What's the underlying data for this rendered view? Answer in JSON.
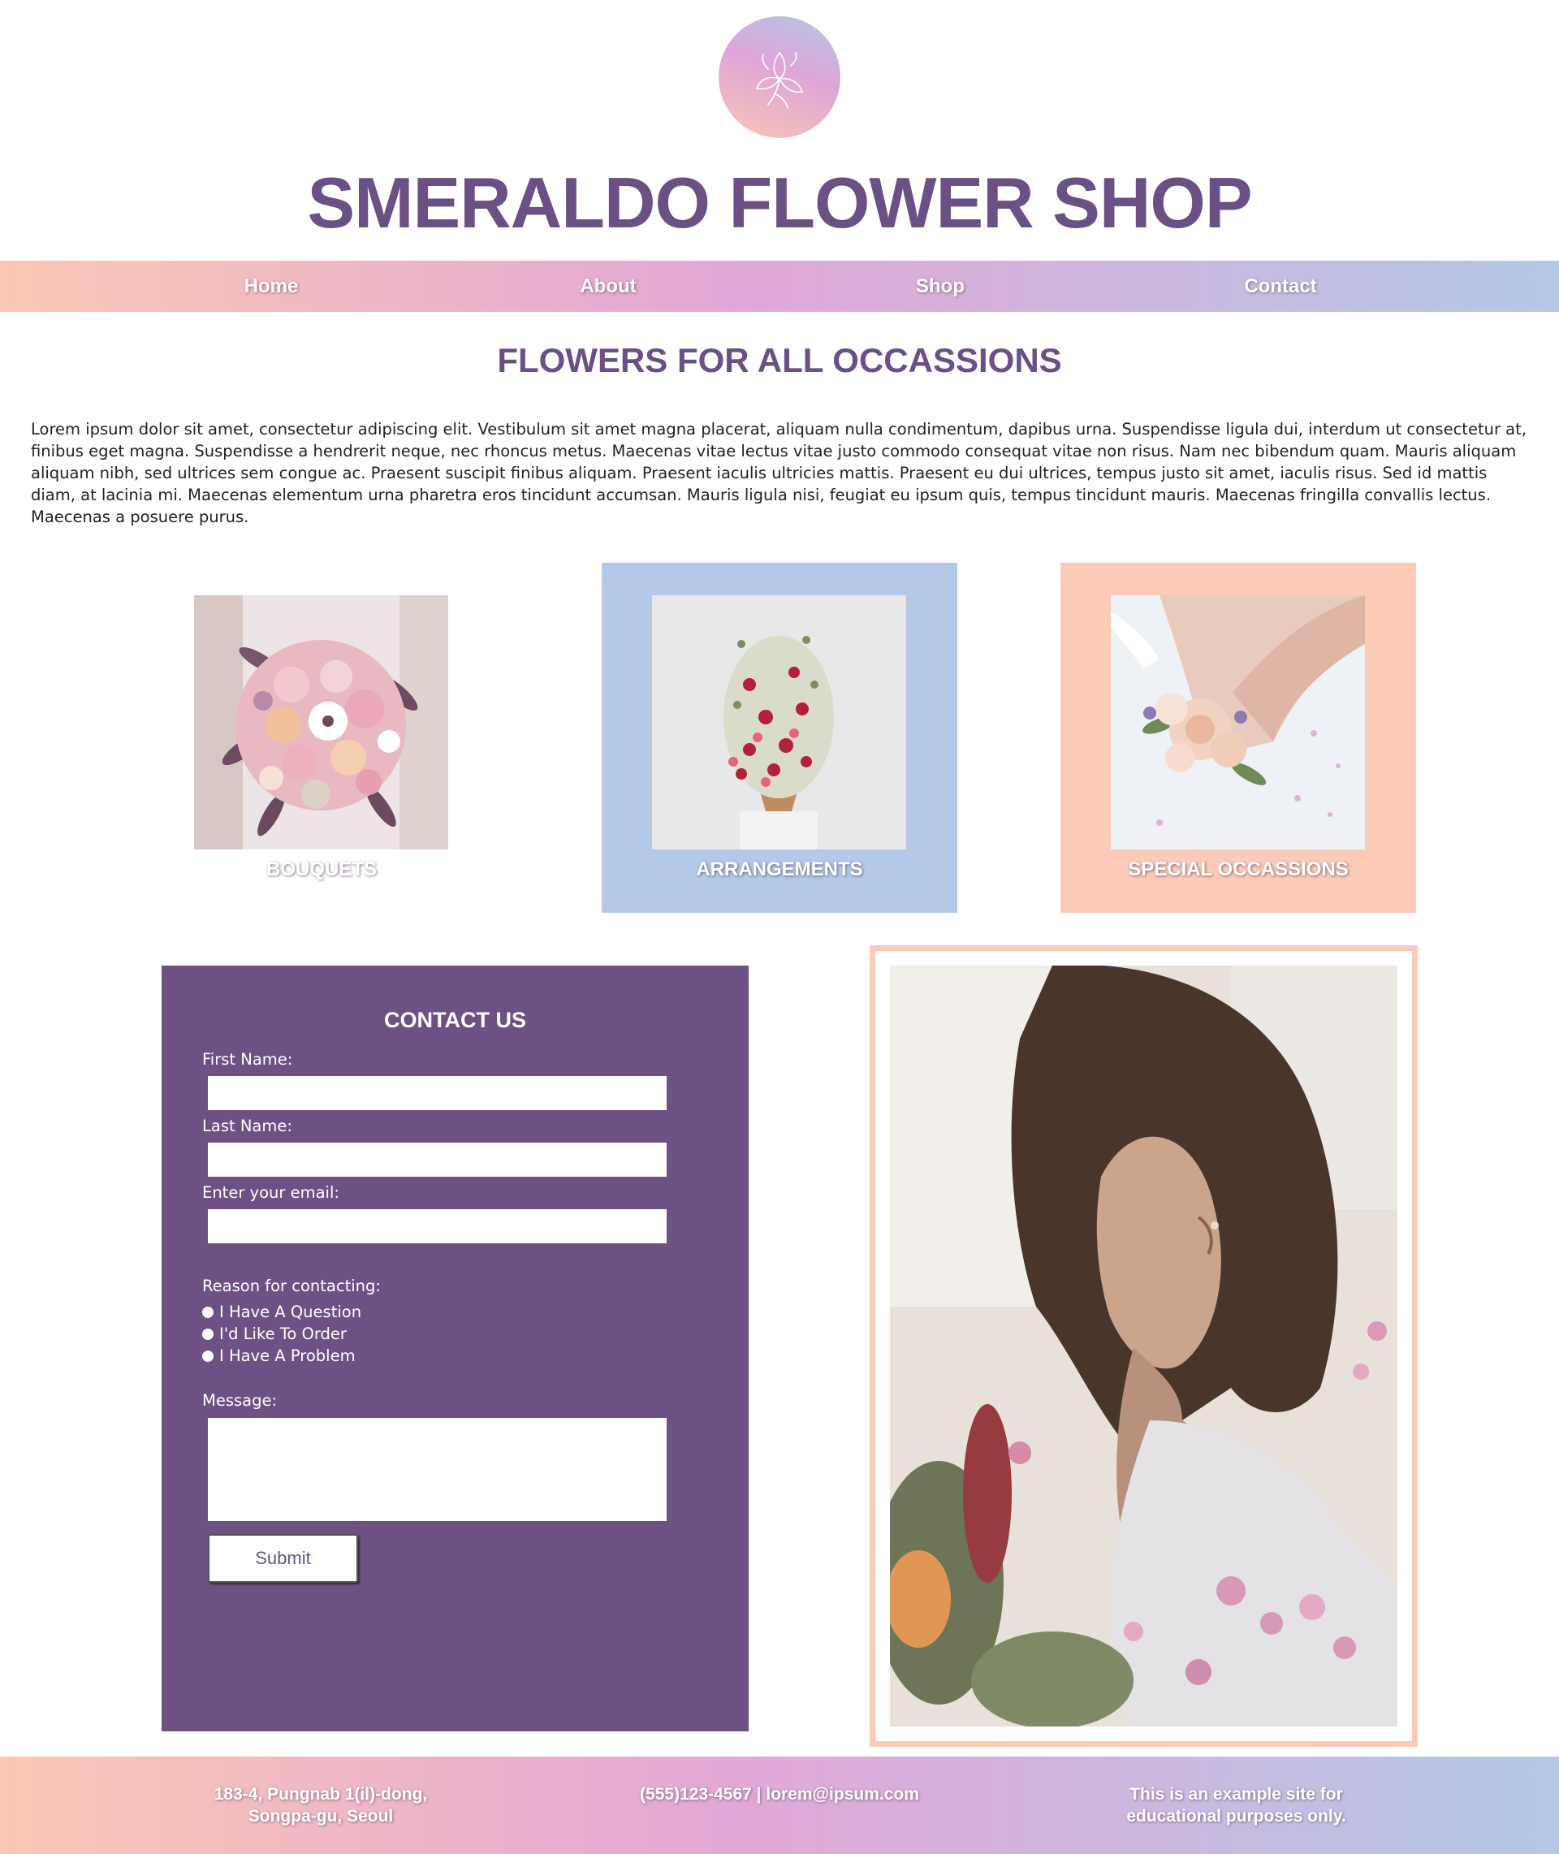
{
  "brand": {
    "title": "SMERALDO FLOWER SHOP",
    "logo_icon": "flower-line-icon",
    "accent_color": "#6b5085",
    "gradient_colors": [
      "#fbc7b4",
      "#e2a7d6",
      "#b4c8e7"
    ]
  },
  "nav": {
    "items": [
      {
        "label": "Home"
      },
      {
        "label": "About"
      },
      {
        "label": "Shop"
      },
      {
        "label": "Contact"
      }
    ]
  },
  "intro": {
    "heading": "FLOWERS FOR ALL OCCASSIONS",
    "body": "Lorem ipsum dolor sit amet, consectetur adipiscing elit. Vestibulum sit amet magna placerat, aliquam nulla condimentum, dapibus urna. Suspendisse ligula dui, interdum ut consectetur at, finibus eget magna. Suspendisse a hendrerit neque, nec rhoncus metus. Maecenas vitae lectus vitae justo commodo consequat vitae non risus. Nam nec bibendum quam. Mauris aliquam aliquam nibh, sed ultrices sem congue ac. Praesent suscipit finibus aliquam. Praesent iaculis ultricies mattis. Praesent eu dui ultrices, tempus justo sit amet, iaculis risus. Sed id mattis diam, at lacinia mi. Maecenas elementum urna pharetra eros tincidunt accumsan. Mauris ligula nisi, feugiat eu ipsum quis, tempus tincidunt mauris. Maecenas fringilla convallis lectus. Maecenas a posuere purus."
  },
  "categories": [
    {
      "label": "BOUQUETS",
      "color": "#dfa5d7"
    },
    {
      "label": "ARRANGEMENTS",
      "color": "#b4c8e7"
    },
    {
      "label": "SPECIAL OCCASSIONS",
      "color": "#fccbb8"
    }
  ],
  "contact": {
    "title": "CONTACT US",
    "panel_color": "#6d5184",
    "first_name_label": "First Name:",
    "first_name_value": "",
    "last_name_label": "Last Name:",
    "last_name_value": "",
    "email_label": "Enter your email:",
    "email_value": "",
    "reason_label": "Reason for contacting:",
    "reasons": [
      "I Have A Question",
      "I'd Like To Order",
      "I Have A Problem"
    ],
    "message_label": "Message:",
    "message_value": "",
    "submit_label": "Submit"
  },
  "footer": {
    "address": "183-4, Pungnab 1(il)-dong, Songpa-gu, Seoul",
    "contact_line": "(555)123-4567 | lorem@ipsum.com",
    "disclaimer": "This is an example site for educational purposes only."
  }
}
